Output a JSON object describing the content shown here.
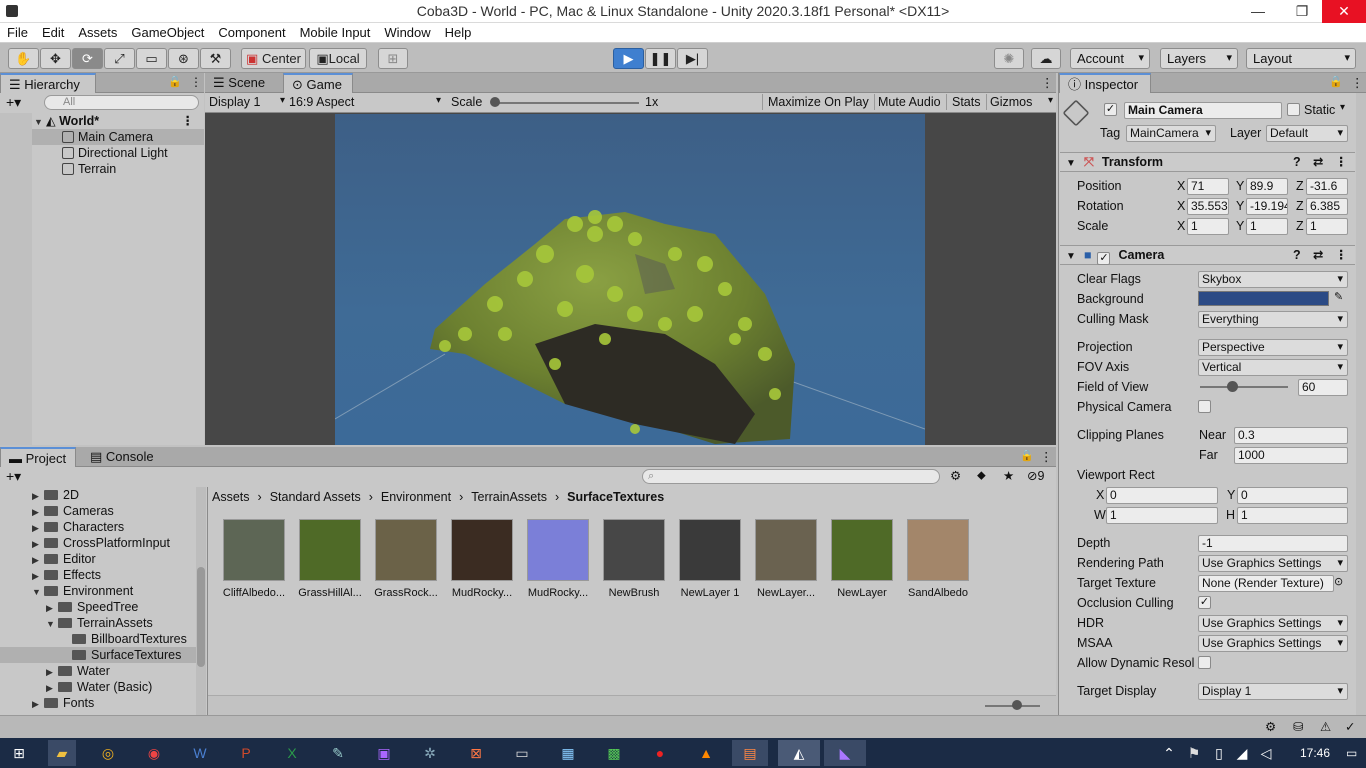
{
  "window": {
    "title": "Coba3D - World - PC, Mac & Linux Standalone - Unity 2020.3.18f1 Personal* <DX11>",
    "minimize": "—",
    "maximize": "❐",
    "close": "✕"
  },
  "menu": [
    "File",
    "Edit",
    "Assets",
    "GameObject",
    "Component",
    "Mobile Input",
    "Window",
    "Help"
  ],
  "toolbar": {
    "pivot": "Center",
    "space": "Local",
    "account": "Account",
    "layers": "Layers",
    "layout": "Layout"
  },
  "hierarchy": {
    "tab": "Hierarchy",
    "search_placeholder": "All",
    "scene": "World*",
    "items": [
      "Main Camera",
      "Directional Light",
      "Terrain"
    ]
  },
  "game": {
    "tabs": [
      "Scene",
      "Game"
    ],
    "display": "Display 1",
    "aspect": "16:9 Aspect",
    "scale_label": "Scale",
    "scale_value": "1x",
    "maximize": "Maximize On Play",
    "mute": "Mute Audio",
    "stats": "Stats",
    "gizmos": "Gizmos"
  },
  "project": {
    "tabs": [
      "Project",
      "Console"
    ],
    "hidden_count": "9",
    "breadcrumb": [
      "Assets",
      "Standard Assets",
      "Environment",
      "TerrainAssets",
      "SurfaceTextures"
    ],
    "tree": [
      {
        "label": "2D",
        "indent": 0,
        "arrow": "▶"
      },
      {
        "label": "Cameras",
        "indent": 0,
        "arrow": "▶"
      },
      {
        "label": "Characters",
        "indent": 0,
        "arrow": "▶"
      },
      {
        "label": "CrossPlatformInput",
        "indent": 0,
        "arrow": "▶"
      },
      {
        "label": "Editor",
        "indent": 0,
        "arrow": "▶"
      },
      {
        "label": "Effects",
        "indent": 0,
        "arrow": "▶"
      },
      {
        "label": "Environment",
        "indent": 0,
        "arrow": "▼"
      },
      {
        "label": "SpeedTree",
        "indent": 1,
        "arrow": "▶"
      },
      {
        "label": "TerrainAssets",
        "indent": 1,
        "arrow": "▼"
      },
      {
        "label": "BillboardTextures",
        "indent": 2,
        "arrow": ""
      },
      {
        "label": "SurfaceTextures",
        "indent": 2,
        "arrow": ""
      },
      {
        "label": "Water",
        "indent": 1,
        "arrow": "▶"
      },
      {
        "label": "Water (Basic)",
        "indent": 1,
        "arrow": "▶"
      },
      {
        "label": "Fonts",
        "indent": 0,
        "arrow": "▶"
      }
    ],
    "assets": [
      {
        "name": "CliffAlbedo...",
        "color": "#5d6655"
      },
      {
        "name": "GrassHillAl...",
        "color": "#4f6a27"
      },
      {
        "name": "GrassRock...",
        "color": "#6b6248"
      },
      {
        "name": "MudRocky...",
        "color": "#3b2c22"
      },
      {
        "name": "MudRocky...",
        "color": "#7b7fd8"
      },
      {
        "name": "NewBrush",
        "color": "#474747"
      },
      {
        "name": "NewLayer 1",
        "color": "#3a3a3a"
      },
      {
        "name": "NewLayer...",
        "color": "#6a6250"
      },
      {
        "name": "NewLayer",
        "color": "#4f6a27"
      },
      {
        "name": "SandAlbedo",
        "color": "#a3866a"
      }
    ]
  },
  "inspector": {
    "tab": "Inspector",
    "object_name": "Main Camera",
    "static_label": "Static",
    "tag_label": "Tag",
    "tag": "MainCamera",
    "layer_label": "Layer",
    "layer": "Default",
    "transform": {
      "title": "Transform",
      "rows": [
        {
          "label": "Position",
          "x": "71",
          "y": "89.9",
          "z": "-31.6"
        },
        {
          "label": "Rotation",
          "x": "35.553",
          "y": "-19.194",
          "z": "6.385"
        },
        {
          "label": "Scale",
          "x": "1",
          "y": "1",
          "z": "1"
        }
      ]
    },
    "camera": {
      "title": "Camera",
      "clear_flags_label": "Clear Flags",
      "clear_flags": "Skybox",
      "background_label": "Background",
      "background_color": "#2b4a85",
      "culling_label": "Culling Mask",
      "culling": "Everything",
      "projection_label": "Projection",
      "projection": "Perspective",
      "fov_axis_label": "FOV Axis",
      "fov_axis": "Vertical",
      "fov_label": "Field of View",
      "fov": "60",
      "physical_label": "Physical Camera",
      "clipping_label": "Clipping Planes",
      "near_label": "Near",
      "near": "0.3",
      "far_label": "Far",
      "far": "1000",
      "viewport_label": "Viewport Rect",
      "vx_label": "X",
      "vx": "0",
      "vy_label": "Y",
      "vy": "0",
      "vw_label": "W",
      "vw": "1",
      "vh_label": "H",
      "vh": "1",
      "depth_label": "Depth",
      "depth": "-1",
      "rendering_label": "Rendering Path",
      "rendering": "Use Graphics Settings",
      "target_tex_label": "Target Texture",
      "target_tex": "None (Render Texture)",
      "occlusion_label": "Occlusion Culling",
      "hdr_label": "HDR",
      "hdr": "Use Graphics Settings",
      "msaa_label": "MSAA",
      "msaa": "Use Graphics Settings",
      "dynres_label": "Allow Dynamic Resol",
      "target_display_label": "Target Display",
      "target_display": "Display 1"
    }
  },
  "taskbar": {
    "time": "17:46"
  }
}
